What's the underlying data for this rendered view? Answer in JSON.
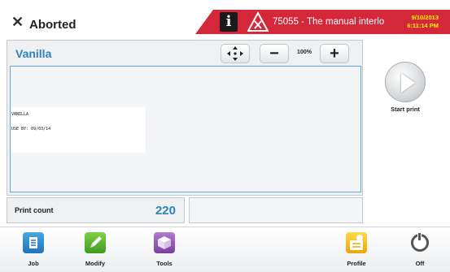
{
  "header": {
    "status_symbol": "✕",
    "status": "Aborted",
    "alert_code": "75055 - The manual interlo",
    "alert_date": "9/10/2013",
    "alert_time": "6:11:14 PM",
    "alert_color": "#d4283a"
  },
  "main": {
    "job_name": "Vanilla",
    "zoom_level": "100%",
    "zoom_out_label": "−",
    "zoom_in_label": "+",
    "move_icon": "move-arrows-icon",
    "label_lines": [
      "VANILLA",
      "USE BY: 09/03/14"
    ]
  },
  "start_print": {
    "label": "Start print",
    "icon": "play-icon"
  },
  "print_count": {
    "label": "Print count",
    "value": "220"
  },
  "toolbar": {
    "items": [
      {
        "label": "Job",
        "icon": "job-icon"
      },
      {
        "label": "Modify",
        "icon": "pencil-icon"
      },
      {
        "label": "Tools",
        "icon": "tools-box-icon"
      },
      {
        "label": "Profile",
        "icon": "profile-icon"
      },
      {
        "label": "Off",
        "icon": "power-icon"
      }
    ]
  },
  "colors": {
    "accent": "#2b84b9",
    "alert": "#d4283a",
    "alert_date": "#fff200"
  }
}
